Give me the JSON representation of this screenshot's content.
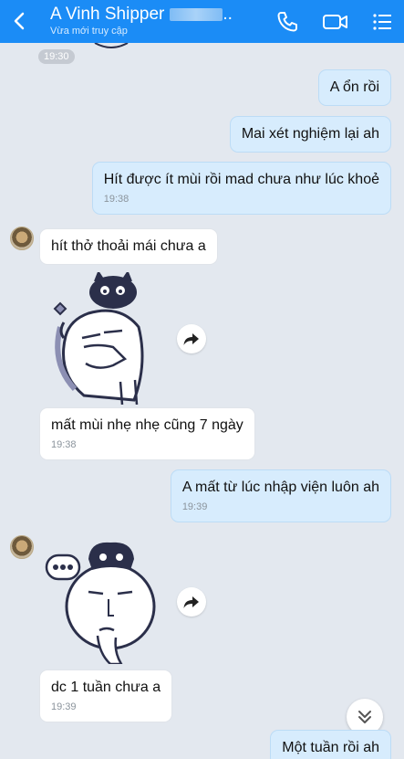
{
  "header": {
    "title": "A Vinh Shipper",
    "status": "Vừa mới truy cập",
    "title_suffix": "..",
    "bg_color": "#1b8cf6"
  },
  "messages": [
    {
      "direction": "in",
      "timestamp": "19:30"
    },
    {
      "direction": "out",
      "text": "A ổn rồi"
    },
    {
      "direction": "out",
      "text": "Mai xét nghiệm lại ah"
    },
    {
      "direction": "out",
      "text": "Hít được ít mùi rồi mad chưa như lúc khoẻ",
      "timestamp": "19:38"
    },
    {
      "direction": "in",
      "text": "hít thở thoải mái chưa a"
    },
    {
      "direction": "in",
      "type": "sticker",
      "sticker": "face-with-cat-hat-sticker"
    },
    {
      "direction": "in",
      "text": "mất mùi nhẹ nhẹ cũng 7 ngày",
      "timestamp": "19:38"
    },
    {
      "direction": "out",
      "text": "A mất từ lúc nhập viện luôn ah",
      "timestamp": "19:39"
    },
    {
      "direction": "in",
      "type": "sticker",
      "sticker": "thinking-face-sticker"
    },
    {
      "direction": "in",
      "text": "dc 1 tuần chưa a",
      "timestamp": "19:39"
    },
    {
      "direction": "out",
      "text": "Một tuần rồi ah"
    }
  ]
}
